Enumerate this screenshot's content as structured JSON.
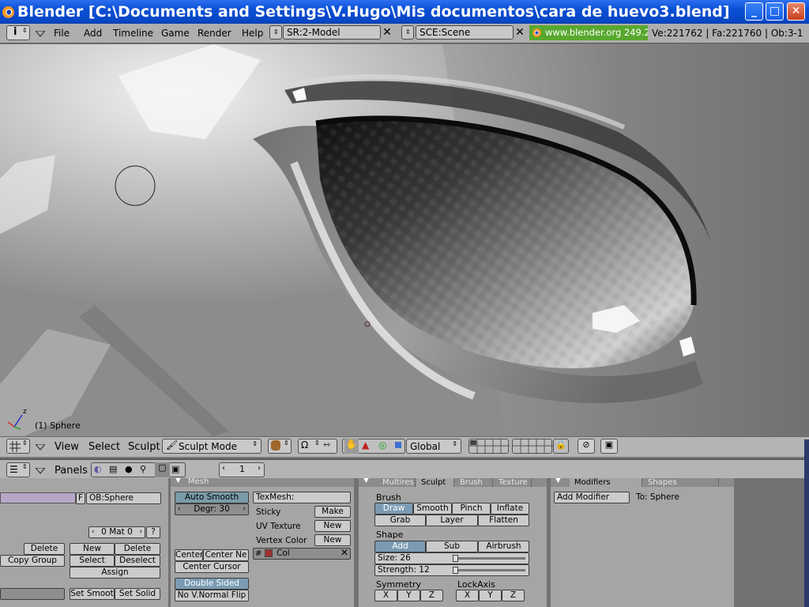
{
  "window": {
    "title": "Blender [C:\\Documents and Settings\\V.Hugo\\Mis documentos\\cara de huevo3.blend]",
    "buttons": {
      "minimize": "_",
      "maximize": "□",
      "close": "✕"
    }
  },
  "infobar": {
    "menu": [
      "File",
      "Add",
      "Timeline",
      "Game",
      "Render",
      "Help"
    ],
    "screen": "SR:2-Model",
    "scene": "SCE:Scene",
    "website": "www.blender.org 249.2",
    "stats": "Ve:221762 | Fa:221760 | Ob:3-1"
  },
  "viewport": {
    "object_label": "(1) Sphere",
    "axis_z": "z"
  },
  "view3d_header": {
    "menu": [
      "View",
      "Select",
      "Sculpt"
    ],
    "mode": "Sculpt Mode",
    "orientation": "Global"
  },
  "buttons_header": {
    "panels_label": "Panels",
    "frame": "1"
  },
  "link_panel": {
    "f_label": "F",
    "object": "OB:Sphere",
    "mat": "0 Mat 0",
    "question": "?",
    "delete": "Delete",
    "new": "New",
    "delete2": "Delete",
    "copy_group": "Copy Group",
    "select": "Select",
    "deselect": "Deselect",
    "assign": "Assign",
    "set_smooth": "Set Smoot",
    "set_solid": "Set Solid"
  },
  "mesh_panel": {
    "tab": "Mesh",
    "auto_smooth": "Auto Smooth",
    "degr": "Degr: 30",
    "texmesh": "TexMesh:",
    "sticky": "Sticky",
    "make": "Make",
    "uv_texture": "UV Texture",
    "new1": "New",
    "vertex_color": "Vertex Color",
    "new2": "New",
    "center": "Center",
    "center_new": "Center Ne",
    "center_cursor": "Center Cursor",
    "col": "Col",
    "double_sided": "Double Sided",
    "normal_flip": "No V.Normal Flip"
  },
  "sculpt_panel": {
    "tabs": [
      "Multires",
      "Sculpt",
      "Brush",
      "Texture"
    ],
    "brush_label": "Brush",
    "brushes_row1": [
      "Draw",
      "Smooth",
      "Pinch",
      "Inflate"
    ],
    "brushes_row2": [
      "Grab",
      "Layer",
      "Flatten"
    ],
    "shape_label": "Shape",
    "shape_ops": [
      "Add",
      "Sub",
      "Airbrush"
    ],
    "size": "Size: 26",
    "size_value": 26,
    "strength": "Strength: 12",
    "strength_value": 12,
    "symmetry_label": "Symmetry",
    "lockaxis_label": "LockAxis",
    "axes": [
      "X",
      "Y",
      "Z"
    ]
  },
  "modifiers_panel": {
    "tabs": [
      "Modifiers",
      "Shapes"
    ],
    "add_modifier": "Add Modifier",
    "to": "To: Sphere"
  }
}
